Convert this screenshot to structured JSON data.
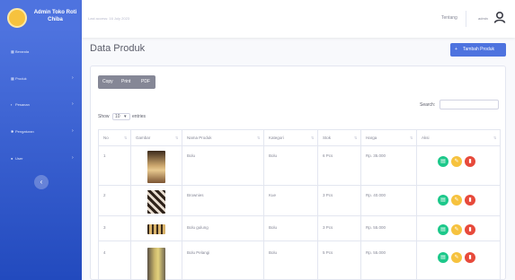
{
  "brand": {
    "title": "Admin Toko Roti Chiba"
  },
  "sidebar": {
    "items": [
      {
        "label": "Beranda",
        "has_children": false
      },
      {
        "label": "Produk",
        "has_children": true
      },
      {
        "label": "Pesanan",
        "has_children": true
      },
      {
        "label": "Pengaturan",
        "has_children": true
      },
      {
        "label": "User",
        "has_children": true
      }
    ]
  },
  "topbar": {
    "last_access": "Last access: 16 July 2023",
    "link": "Tentang",
    "user": "admin"
  },
  "page": {
    "title": "Data Produk",
    "add_button": "Tambah Produk"
  },
  "table_controls": {
    "buttons": [
      "Copy",
      "Print",
      "PDF"
    ],
    "show_label": "Show",
    "entries_value": "10",
    "entries_label": "entries",
    "search_label": "Search:"
  },
  "table": {
    "headers": [
      "No",
      "Gambar",
      "Nama Produk",
      "Kategori",
      "Stok",
      "Harga",
      "Aksi"
    ],
    "rows": [
      {
        "no": "1",
        "nama": "Bolu",
        "kategori": "Bolu",
        "stok": "6 Pcs",
        "harga": "Rp. 35.000"
      },
      {
        "no": "2",
        "nama": "Brownies",
        "kategori": "Kue",
        "stok": "3 Pcs",
        "harga": "Rp. 40.000"
      },
      {
        "no": "3",
        "nama": "Bolu gulung",
        "kategori": "Bolu",
        "stok": "3 Pcs",
        "harga": "Rp. 55.000"
      },
      {
        "no": "4",
        "nama": "Bolu Pelangi",
        "kategori": "Bolu",
        "stok": "5 Pcs",
        "harga": "Rp. 55.000"
      }
    ]
  },
  "colors": {
    "primary": "#4e73df",
    "view": "#1cc88a",
    "edit": "#f6c23e",
    "delete": "#e74a3b"
  }
}
